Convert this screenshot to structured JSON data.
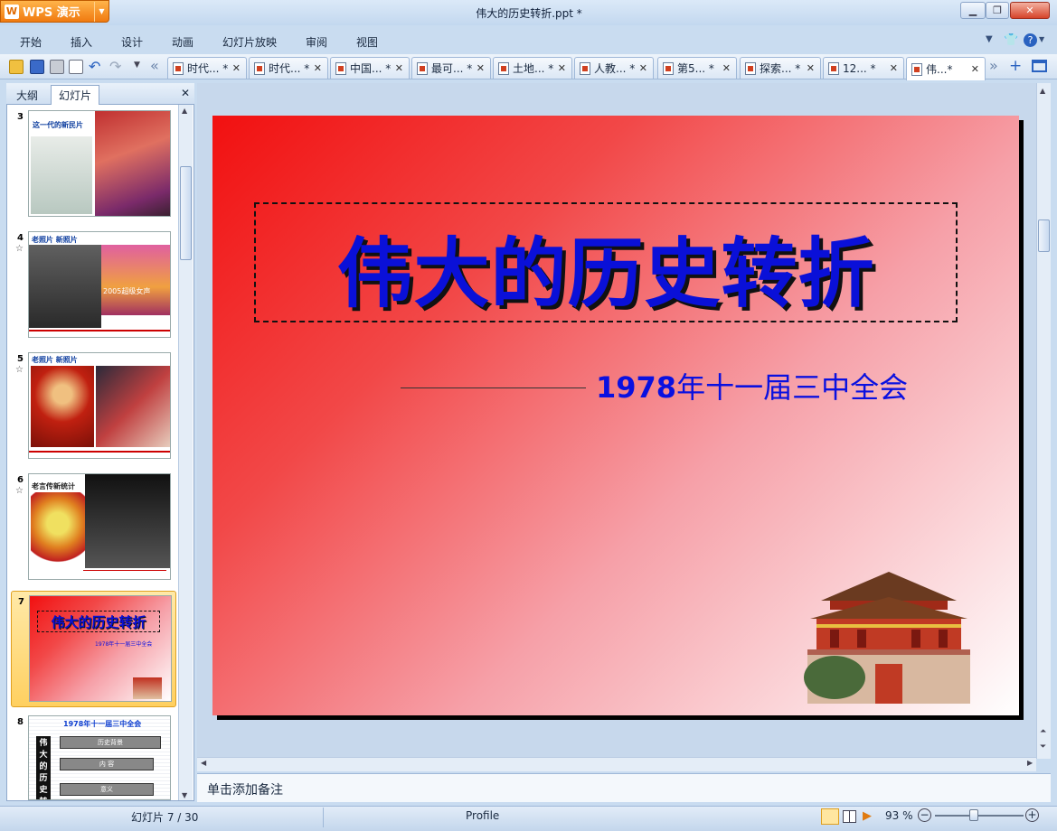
{
  "app": {
    "name": "WPS 演示",
    "window_title": "伟大的历史转折.ppt *"
  },
  "menu": [
    "开始",
    "插入",
    "设计",
    "动画",
    "幻灯片放映",
    "审阅",
    "视图"
  ],
  "tabs": [
    {
      "label": "时代... *",
      "active": false
    },
    {
      "label": "时代... *",
      "active": false
    },
    {
      "label": "中国... *",
      "active": false
    },
    {
      "label": "最可... *",
      "active": false
    },
    {
      "label": "土地... *",
      "active": false
    },
    {
      "label": "人教... *",
      "active": false
    },
    {
      "label": "第5... *",
      "active": false
    },
    {
      "label": "探索... *",
      "active": false
    },
    {
      "label": "12... *",
      "active": false
    },
    {
      "label": "伟...*",
      "active": true
    }
  ],
  "panel": {
    "tabs": [
      {
        "label": "大纲",
        "active": false
      },
      {
        "label": "幻灯片",
        "active": true
      }
    ],
    "thumbnails": [
      {
        "number": "3",
        "star": false,
        "caption": "这一代的新民片",
        "sub": ""
      },
      {
        "number": "4",
        "star": true,
        "caption": "老照片 新照片",
        "sub": "2005超级女声"
      },
      {
        "number": "5",
        "star": true,
        "caption": "老照片 新照片",
        "sub": ""
      },
      {
        "number": "6",
        "star": true,
        "caption": "老言传新统计",
        "sub": ""
      },
      {
        "number": "7",
        "star": false,
        "caption": "伟大的历史转折",
        "sub": "1978年十一届三中全会",
        "selected": true
      },
      {
        "number": "8",
        "star": false,
        "caption": "1978年十一届三中全会",
        "sub": "伟大的历史转折"
      }
    ],
    "outline_boxes": [
      "历史背景",
      "内 容",
      "意义"
    ]
  },
  "slide": {
    "title": "伟大的历史转折",
    "subtitle_year": "1978",
    "subtitle_rest": "年十一届三中全会"
  },
  "notes": {
    "placeholder": "单击添加备注"
  },
  "status": {
    "slide_counter": "幻灯片 7 / 30",
    "profile": "Profile",
    "zoom": "93 %"
  },
  "colors": {
    "accent": "#f07a10",
    "title_blue": "#0a10d8",
    "selected": "#ffd060"
  },
  "icons": [
    "wps-logo-icon",
    "help-icon",
    "skin-icon",
    "open-icon",
    "save-icon",
    "print-icon",
    "preview-icon",
    "undo-icon",
    "redo-icon",
    "nav-left-icon",
    "nav-right-icon",
    "new-tab-icon"
  ]
}
